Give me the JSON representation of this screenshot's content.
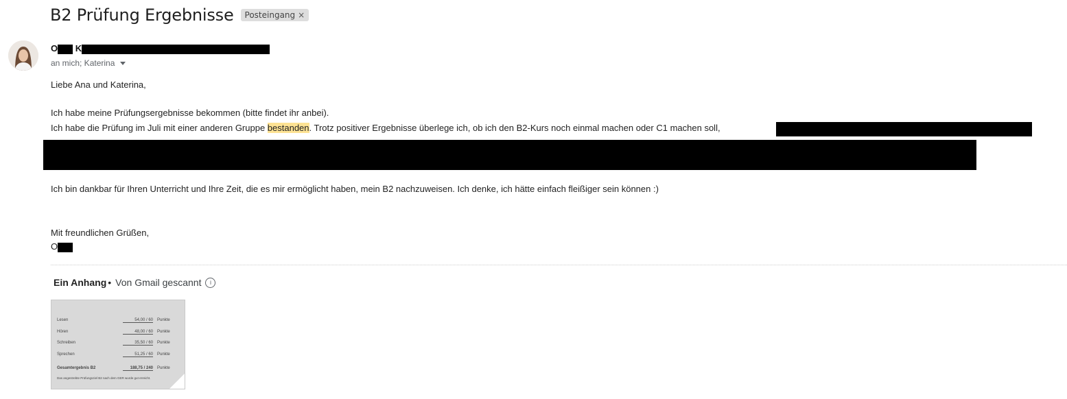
{
  "subject": "B2 Prüfung Ergebnisse",
  "label_chip": {
    "text": "Posteingang",
    "close": "×"
  },
  "sender": {
    "name_start": "O",
    "name_mid": "K"
  },
  "recipients": "an mich; Katerina",
  "body": {
    "greeting": "Liebe Ana und Katerina,",
    "line1": "Ich habe meine Prüfungsergebnisse bekommen (bitte findet ihr anbei).",
    "line2_pre": "Ich habe die Prüfung im Juli mit einer anderen Gruppe ",
    "line2_highlight": "bestanden",
    "line2_post": ". Trotz positiver Ergebnisse überlege ich, ob ich den B2-Kurs noch einmal machen oder C1 machen soll,",
    "line3": "Ich bin dankbar für Ihren Unterricht und Ihre Zeit, die es mir ermöglicht haben, mein B2 nachzuweisen. Ich denke, ich hätte einfach fleißiger sein können :)",
    "closing": "Mit freundlichen Grüßen,",
    "signature": "O"
  },
  "attachments": {
    "title": "Ein Anhang",
    "separator": "•",
    "scan_note": "Von Gmail gescannt",
    "info_icon": "info-icon",
    "thumbnail": {
      "rows": [
        {
          "label": "Lesen",
          "value": "54,00 / 60",
          "unit": "Punkte"
        },
        {
          "label": "Hören",
          "value": "48,00 / 60",
          "unit": "Punkte"
        },
        {
          "label": "Schreiben",
          "value": "35,50 / 60",
          "unit": "Punkte"
        },
        {
          "label": "Sprechen",
          "value": "51,25 / 60",
          "unit": "Punkte"
        },
        {
          "label": "Gesamtergebnis B2",
          "value": "188,75 / 240",
          "unit": "Punkte"
        }
      ],
      "note": "Das angestrebte Prüfungsziel B2 nach dem GER wurde gut erreicht."
    }
  },
  "colors": {
    "highlight": "#fde293",
    "chip_bg": "#dddddd",
    "redaction": "#000000"
  }
}
